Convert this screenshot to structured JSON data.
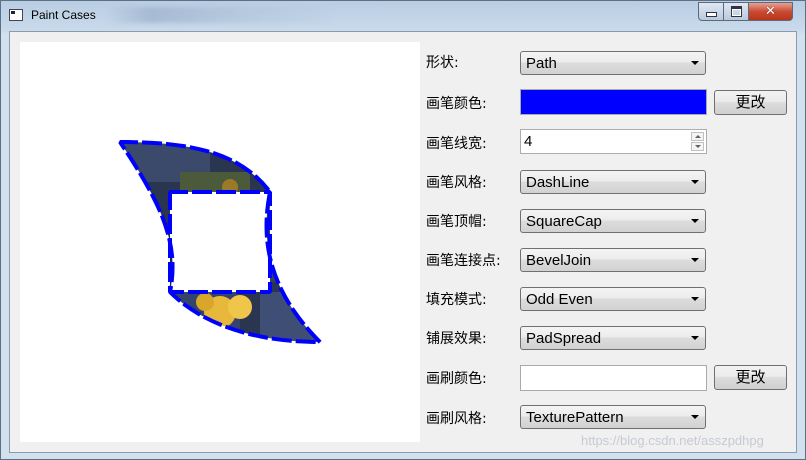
{
  "window": {
    "title": "Paint Cases",
    "close_glyph": "✕"
  },
  "colors": {
    "pen_color": "#0000ff",
    "brush_color": "#ffffff",
    "texture_dark": "#24304a",
    "texture_flower": "#e8b83a"
  },
  "form": {
    "shape": {
      "label": "形状:",
      "value": "Path"
    },
    "pen_color": {
      "label": "画笔颜色:",
      "button": "更改"
    },
    "pen_width": {
      "label": "画笔线宽:",
      "value": "4"
    },
    "pen_style": {
      "label": "画笔风格:",
      "value": "DashLine"
    },
    "pen_cap": {
      "label": "画笔顶帽:",
      "value": "SquareCap"
    },
    "pen_join": {
      "label": "画笔连接点:",
      "value": "BevelJoin"
    },
    "fill_mode": {
      "label": "填充模式:",
      "value": "Odd Even"
    },
    "spread": {
      "label": "铺展效果:",
      "value": "PadSpread"
    },
    "brush_color": {
      "label": "画刷颜色:",
      "button": "更改"
    },
    "brush_style": {
      "label": "画刷风格:",
      "value": "TexturePattern"
    }
  },
  "watermark": "https://blog.csdn.net/asszpdhpg"
}
